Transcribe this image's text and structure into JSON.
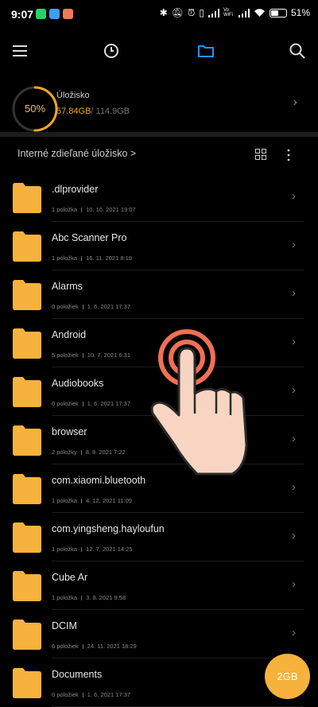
{
  "status_bar": {
    "time": "9:07",
    "battery_percent": "51%",
    "battery_level": 0.51,
    "icons": [
      "whatsapp-icon",
      "messenger-icon",
      "gallery-icon",
      "bluetooth-icon",
      "mute-icon",
      "alarm-icon",
      "vibrate-icon",
      "signal-icon",
      "vowifi-icon",
      "signal-icon",
      "wifi-icon",
      "battery-icon"
    ],
    "vowifi_text": "Vo WiFi"
  },
  "toolbar": {
    "icons": [
      "menu-icon",
      "recent-icon",
      "folder-icon",
      "search-icon"
    ],
    "active_tab": "folder-icon",
    "accent_color": "#2196f3"
  },
  "storage": {
    "percent_label": "50%",
    "percent_value": 0.5,
    "title": "Úložisko",
    "used": "57.84GB",
    "total": "/ 114.9GB",
    "ring_color": "#f5a623"
  },
  "breadcrumb": {
    "label": "Interné zdieľané úložisko >"
  },
  "files": [
    {
      "name": ".dlprovider",
      "count": "1 položka",
      "date": "10. 10. 2021 19:07"
    },
    {
      "name": "Abc Scanner Pro",
      "count": "1 položka",
      "date": "16. 11. 2021 8:19"
    },
    {
      "name": "Alarms",
      "count": "0 položiek",
      "date": "1. 6. 2021 17:37"
    },
    {
      "name": "Android",
      "count": "5 položiek",
      "date": "10. 7. 2021 6:31"
    },
    {
      "name": "Audiobooks",
      "count": "0 položiek",
      "date": "1. 6. 2021 17:37"
    },
    {
      "name": "browser",
      "count": "2 položky",
      "date": "8. 8. 2021 7:22"
    },
    {
      "name": "com.xiaomi.bluetooth",
      "count": "1 položka",
      "date": "4. 12. 2021 11:09"
    },
    {
      "name": "com.yingsheng.hayloufun",
      "count": "1 položka",
      "date": "12. 7. 2021 14:25"
    },
    {
      "name": "Cube Ar",
      "count": "1 položka",
      "date": "3. 8. 2021 9:58"
    },
    {
      "name": "DCIM",
      "count": "6 položiek",
      "date": "24. 11. 2021 18:29"
    },
    {
      "name": "Documents",
      "count": "0 položiek",
      "date": "1. 6. 2021 17:37"
    }
  ],
  "fab": {
    "label": "2GB",
    "color": "#f6b23c"
  },
  "folder_color": "#f6b23c"
}
